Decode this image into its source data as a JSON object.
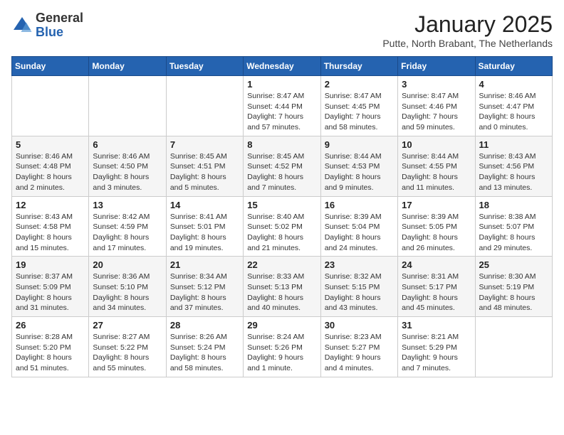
{
  "logo": {
    "general": "General",
    "blue": "Blue"
  },
  "header": {
    "month": "January 2025",
    "location": "Putte, North Brabant, The Netherlands"
  },
  "weekdays": [
    "Sunday",
    "Monday",
    "Tuesday",
    "Wednesday",
    "Thursday",
    "Friday",
    "Saturday"
  ],
  "weeks": [
    [
      {
        "day": "",
        "info": ""
      },
      {
        "day": "",
        "info": ""
      },
      {
        "day": "",
        "info": ""
      },
      {
        "day": "1",
        "info": "Sunrise: 8:47 AM\nSunset: 4:44 PM\nDaylight: 7 hours and 57 minutes."
      },
      {
        "day": "2",
        "info": "Sunrise: 8:47 AM\nSunset: 4:45 PM\nDaylight: 7 hours and 58 minutes."
      },
      {
        "day": "3",
        "info": "Sunrise: 8:47 AM\nSunset: 4:46 PM\nDaylight: 7 hours and 59 minutes."
      },
      {
        "day": "4",
        "info": "Sunrise: 8:46 AM\nSunset: 4:47 PM\nDaylight: 8 hours and 0 minutes."
      }
    ],
    [
      {
        "day": "5",
        "info": "Sunrise: 8:46 AM\nSunset: 4:48 PM\nDaylight: 8 hours and 2 minutes."
      },
      {
        "day": "6",
        "info": "Sunrise: 8:46 AM\nSunset: 4:50 PM\nDaylight: 8 hours and 3 minutes."
      },
      {
        "day": "7",
        "info": "Sunrise: 8:45 AM\nSunset: 4:51 PM\nDaylight: 8 hours and 5 minutes."
      },
      {
        "day": "8",
        "info": "Sunrise: 8:45 AM\nSunset: 4:52 PM\nDaylight: 8 hours and 7 minutes."
      },
      {
        "day": "9",
        "info": "Sunrise: 8:44 AM\nSunset: 4:53 PM\nDaylight: 8 hours and 9 minutes."
      },
      {
        "day": "10",
        "info": "Sunrise: 8:44 AM\nSunset: 4:55 PM\nDaylight: 8 hours and 11 minutes."
      },
      {
        "day": "11",
        "info": "Sunrise: 8:43 AM\nSunset: 4:56 PM\nDaylight: 8 hours and 13 minutes."
      }
    ],
    [
      {
        "day": "12",
        "info": "Sunrise: 8:43 AM\nSunset: 4:58 PM\nDaylight: 8 hours and 15 minutes."
      },
      {
        "day": "13",
        "info": "Sunrise: 8:42 AM\nSunset: 4:59 PM\nDaylight: 8 hours and 17 minutes."
      },
      {
        "day": "14",
        "info": "Sunrise: 8:41 AM\nSunset: 5:01 PM\nDaylight: 8 hours and 19 minutes."
      },
      {
        "day": "15",
        "info": "Sunrise: 8:40 AM\nSunset: 5:02 PM\nDaylight: 8 hours and 21 minutes."
      },
      {
        "day": "16",
        "info": "Sunrise: 8:39 AM\nSunset: 5:04 PM\nDaylight: 8 hours and 24 minutes."
      },
      {
        "day": "17",
        "info": "Sunrise: 8:39 AM\nSunset: 5:05 PM\nDaylight: 8 hours and 26 minutes."
      },
      {
        "day": "18",
        "info": "Sunrise: 8:38 AM\nSunset: 5:07 PM\nDaylight: 8 hours and 29 minutes."
      }
    ],
    [
      {
        "day": "19",
        "info": "Sunrise: 8:37 AM\nSunset: 5:09 PM\nDaylight: 8 hours and 31 minutes."
      },
      {
        "day": "20",
        "info": "Sunrise: 8:36 AM\nSunset: 5:10 PM\nDaylight: 8 hours and 34 minutes."
      },
      {
        "day": "21",
        "info": "Sunrise: 8:34 AM\nSunset: 5:12 PM\nDaylight: 8 hours and 37 minutes."
      },
      {
        "day": "22",
        "info": "Sunrise: 8:33 AM\nSunset: 5:13 PM\nDaylight: 8 hours and 40 minutes."
      },
      {
        "day": "23",
        "info": "Sunrise: 8:32 AM\nSunset: 5:15 PM\nDaylight: 8 hours and 43 minutes."
      },
      {
        "day": "24",
        "info": "Sunrise: 8:31 AM\nSunset: 5:17 PM\nDaylight: 8 hours and 45 minutes."
      },
      {
        "day": "25",
        "info": "Sunrise: 8:30 AM\nSunset: 5:19 PM\nDaylight: 8 hours and 48 minutes."
      }
    ],
    [
      {
        "day": "26",
        "info": "Sunrise: 8:28 AM\nSunset: 5:20 PM\nDaylight: 8 hours and 51 minutes."
      },
      {
        "day": "27",
        "info": "Sunrise: 8:27 AM\nSunset: 5:22 PM\nDaylight: 8 hours and 55 minutes."
      },
      {
        "day": "28",
        "info": "Sunrise: 8:26 AM\nSunset: 5:24 PM\nDaylight: 8 hours and 58 minutes."
      },
      {
        "day": "29",
        "info": "Sunrise: 8:24 AM\nSunset: 5:26 PM\nDaylight: 9 hours and 1 minute."
      },
      {
        "day": "30",
        "info": "Sunrise: 8:23 AM\nSunset: 5:27 PM\nDaylight: 9 hours and 4 minutes."
      },
      {
        "day": "31",
        "info": "Sunrise: 8:21 AM\nSunset: 5:29 PM\nDaylight: 9 hours and 7 minutes."
      },
      {
        "day": "",
        "info": ""
      }
    ]
  ]
}
